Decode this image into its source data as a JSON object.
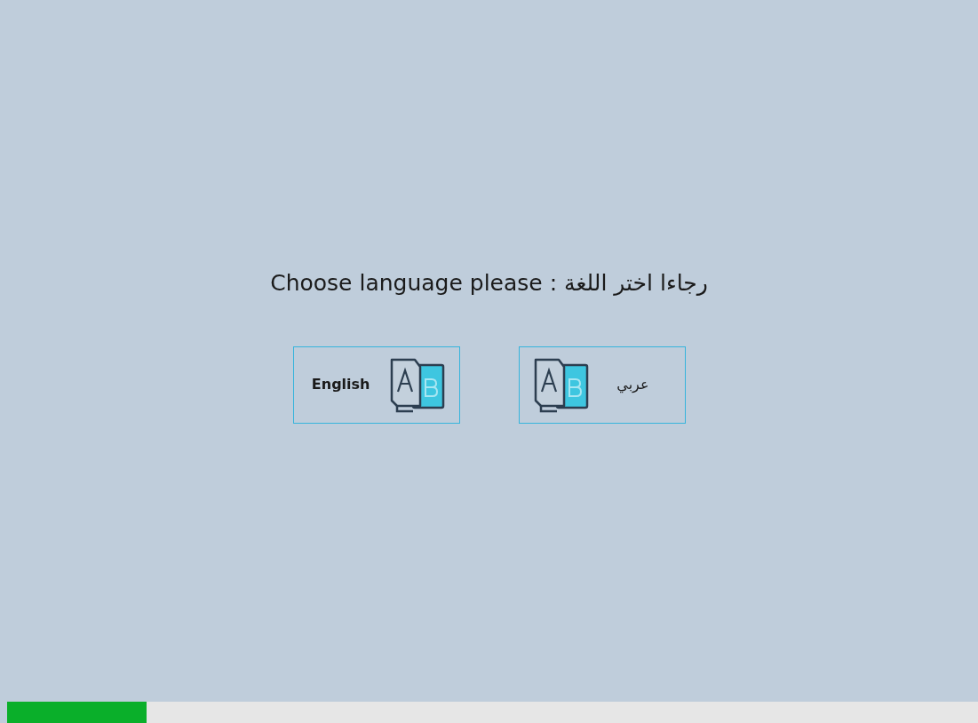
{
  "prompt": "رجاءا اختر اللغة : Choose language please",
  "buttons": [
    {
      "label": "عربي",
      "kind": "arabic"
    },
    {
      "label": "English",
      "kind": "latin"
    }
  ],
  "progress": {
    "level": 0.144
  }
}
